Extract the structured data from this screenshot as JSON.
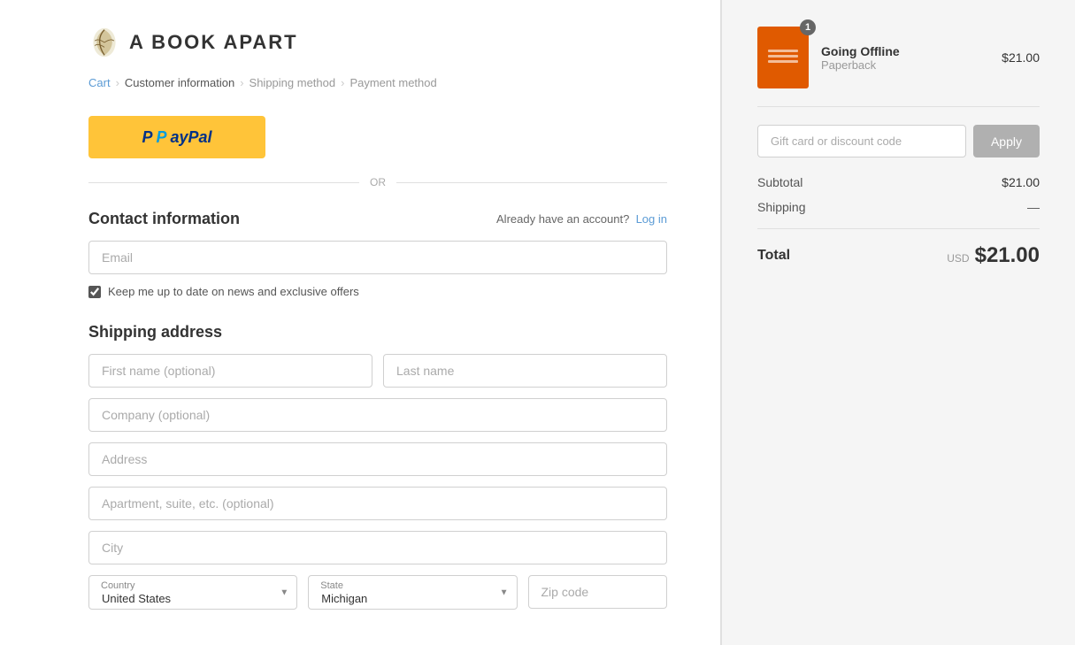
{
  "logo": {
    "text": "A BOOK APART"
  },
  "breadcrumb": {
    "items": [
      "Cart",
      "Customer information",
      "Shipping method",
      "Payment method"
    ],
    "active": "Customer information"
  },
  "paypal": {
    "label": "PayPal"
  },
  "divider": {
    "label": "OR"
  },
  "contact": {
    "title": "Contact information",
    "login_prompt": "Already have an account?",
    "login_link": "Log in",
    "email_placeholder": "Email",
    "newsletter_label": "Keep me up to date on news and exclusive offers"
  },
  "shipping": {
    "title": "Shipping address",
    "first_name_placeholder": "First name (optional)",
    "last_name_placeholder": "Last name",
    "company_placeholder": "Company (optional)",
    "address_placeholder": "Address",
    "apt_placeholder": "Apartment, suite, etc. (optional)",
    "city_placeholder": "City",
    "country_label": "Country",
    "country_value": "United States",
    "state_label": "State",
    "state_value": "Michigan",
    "zip_placeholder": "Zip code"
  },
  "cart": {
    "item": {
      "title": "Going Offline",
      "subtitle": "Paperback",
      "price": "$21.00",
      "quantity": "1"
    },
    "discount_placeholder": "Gift card or discount code",
    "apply_label": "Apply",
    "subtotal_label": "Subtotal",
    "subtotal_value": "$21.00",
    "shipping_label": "Shipping",
    "shipping_value": "—",
    "total_label": "Total",
    "total_currency": "USD",
    "total_value": "$21.00"
  }
}
